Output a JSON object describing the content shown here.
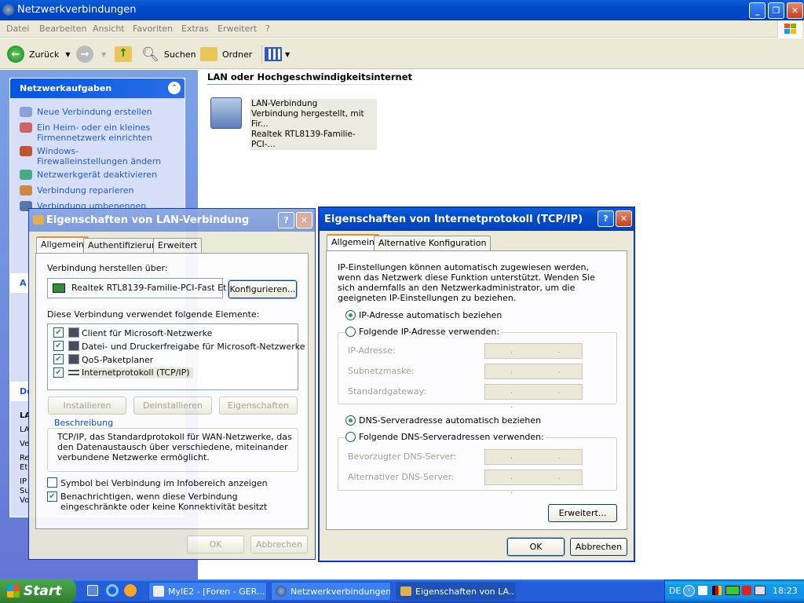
{
  "main_window": {
    "title": "Netzwerkverbindungen",
    "menu": [
      "Datei",
      "Bearbeiten",
      "Ansicht",
      "Favoriten",
      "Extras",
      "Erweitert",
      "?"
    ],
    "toolbar": {
      "back": "Zurück",
      "search": "Suchen",
      "folders": "Ordner"
    },
    "left_pane": {
      "panel_title": "Netzwerkaufgaben",
      "tasks": [
        "Neue Verbindung erstellen",
        "Ein Heim- oder ein kleines Firmennetzwerk einrichten",
        "Windows-Firewalleinstellungen ändern",
        "Netzwerkgerät deaktivieren",
        "Verbindung reparieren",
        "Verbindung umbenennen"
      ],
      "panel2_title_fragment": "A",
      "panel3_title_fragment": "De",
      "panel3_fragments": [
        "LA",
        "LA",
        "Ve",
        "Re",
        "Et",
        "IP",
        "Su",
        "Vo"
      ]
    },
    "content": {
      "group_header": "LAN oder Hochgeschwindigkeitsinternet",
      "connection": {
        "name": "LAN-Verbindung",
        "status": "Verbindung hergestellt, mit Fir...",
        "device": "Realtek RTL8139-Familie-PCI-..."
      }
    }
  },
  "lan_dialog": {
    "title": "Eigenschaften von LAN-Verbindung",
    "tabs": [
      "Allgemein",
      "Authentifizierung",
      "Erweitert"
    ],
    "connect_using_label": "Verbindung herstellen über:",
    "adapter": "Realtek RTL8139-Familie-PCI-Fast Et",
    "configure": "Konfigurieren...",
    "items_label": "Diese Verbindung verwendet folgende Elemente:",
    "items": [
      {
        "label": "Client für Microsoft-Netzwerke",
        "checked": true
      },
      {
        "label": "Datei- und Druckerfreigabe für Microsoft-Netzwerke",
        "checked": true
      },
      {
        "label": "QoS-Paketplaner",
        "checked": true
      },
      {
        "label": "Internetprotokoll (TCP/IP)",
        "checked": true
      }
    ],
    "install": "Installieren",
    "uninstall": "Deinstallieren",
    "properties": "Eigenschaften",
    "description_title": "Beschreibung",
    "description": "TCP/IP, das Standardprotokoll für WAN-Netzwerke, das den Datenaustausch über verschiedene, miteinander verbundene Netzwerke ermöglicht.",
    "show_icon": "Symbol bei Verbindung im Infobereich anzeigen",
    "show_icon_checked": false,
    "notify": "Benachrichtigen, wenn diese Verbindung eingeschränkte oder keine Konnektivität besitzt",
    "notify_checked": true,
    "ok": "OK",
    "cancel": "Abbrechen"
  },
  "tcpip_dialog": {
    "title": "Eigenschaften von Internetprotokoll (TCP/IP)",
    "tabs": [
      "Allgemein",
      "Alternative Konfiguration"
    ],
    "intro": "IP-Einstellungen können automatisch zugewiesen werden, wenn das Netzwerk diese Funktion unterstützt. Wenden Sie sich andernfalls an den Netzwerkadministrator, um die geeigneten IP-Einstellungen zu beziehen.",
    "ip_auto": "IP-Adresse automatisch beziehen",
    "ip_manual": "Folgende IP-Adresse verwenden:",
    "ip_selected": "auto",
    "ip_address": "IP-Adresse:",
    "subnet": "Subnetzmaske:",
    "gateway": "Standardgateway:",
    "dns_auto": "DNS-Serveradresse automatisch beziehen",
    "dns_manual": "Folgende DNS-Serveradressen verwenden:",
    "dns_selected": "auto",
    "dns_preferred": "Bevorzugter DNS-Server:",
    "dns_alternate": "Alternativer DNS-Server:",
    "ip_dots": ". . .",
    "advanced": "Erweitert...",
    "ok": "OK",
    "cancel": "Abbrechen"
  },
  "taskbar": {
    "start": "Start",
    "tasks": [
      {
        "label": "MyIE2 - [Foren - GER...",
        "active": false
      },
      {
        "label": "Netzwerkverbindungen",
        "active": false
      },
      {
        "label": "Eigenschaften von LA...",
        "active": true
      }
    ],
    "language": "DE",
    "clock": "18:23"
  },
  "colors": {
    "title_blue": "#0249c9",
    "dialog_bg": "#ece9d8",
    "task_link": "#215dc6",
    "start_green": "#3c8f3c"
  }
}
